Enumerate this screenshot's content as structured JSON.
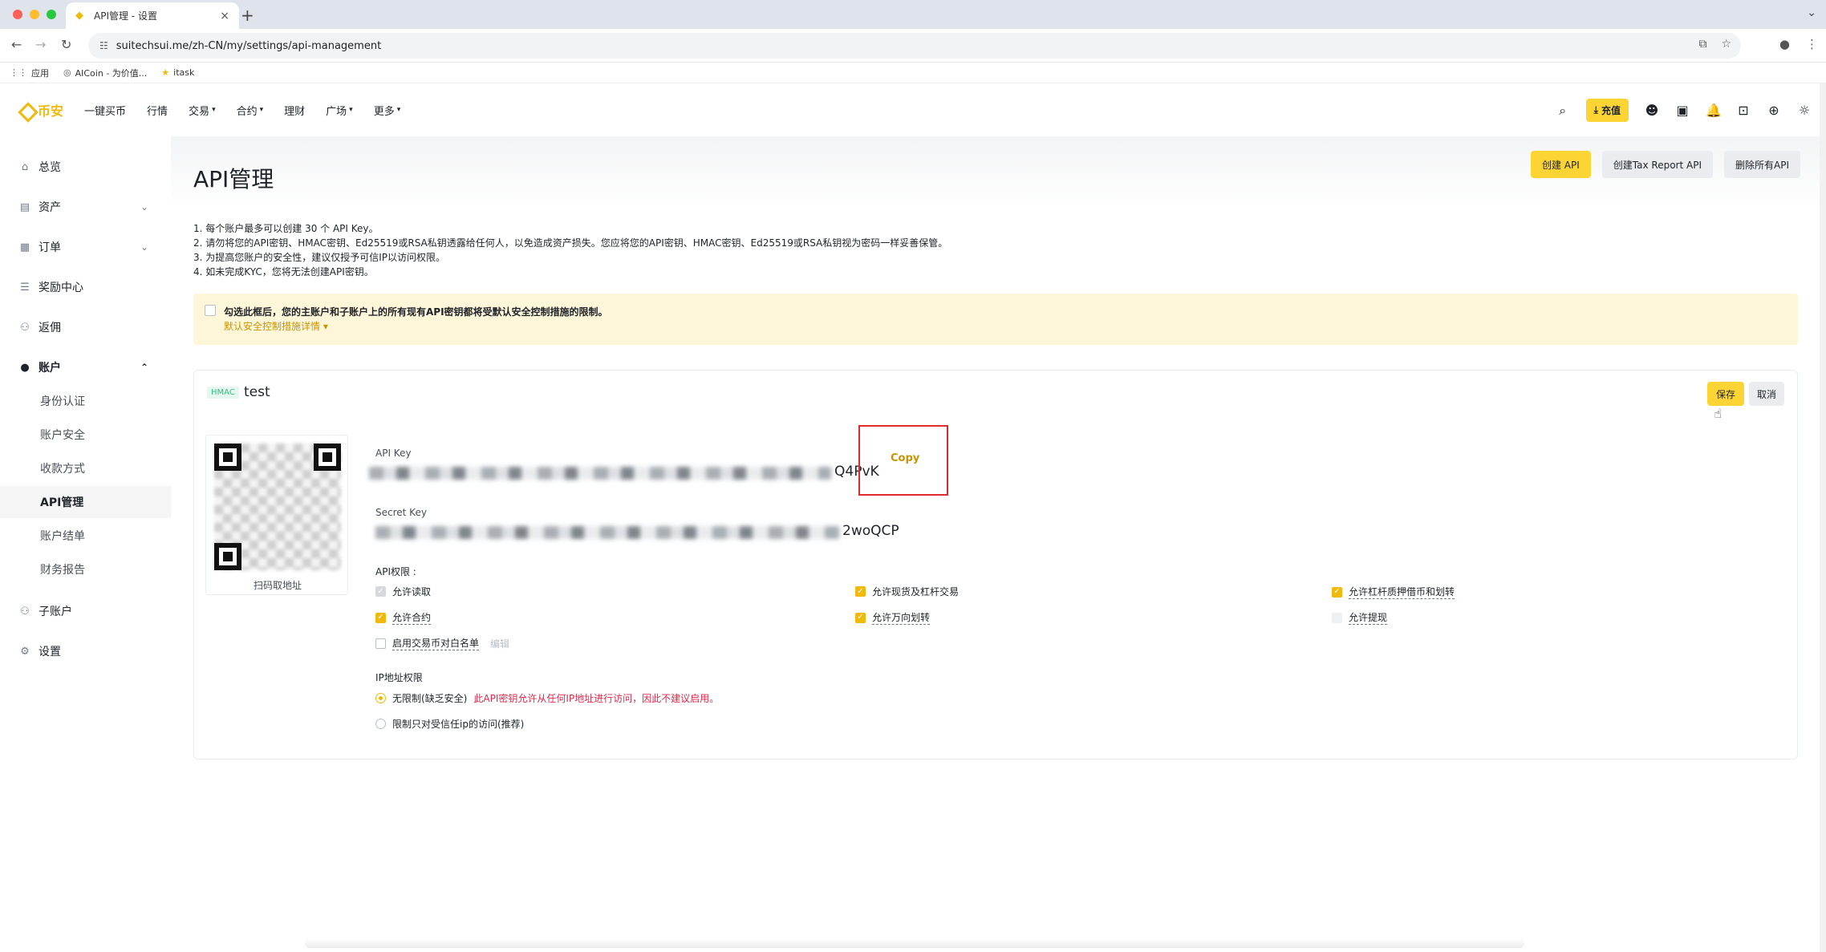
{
  "browser": {
    "tab_title": "API管理 - 设置",
    "url": "suitechsui.me/zh-CN/my/settings/api-management",
    "bookmarks": [
      "应用",
      "AICoin - 为价值...",
      "itask"
    ]
  },
  "header": {
    "logo_text": "币安",
    "nav": [
      "一键买币",
      "行情",
      "交易",
      "合约",
      "理财",
      "广场",
      "更多"
    ],
    "deposit_label": "充值"
  },
  "sidebar": {
    "items": [
      "总览",
      "资产",
      "订单",
      "奖励中心",
      "返佣",
      "账户"
    ],
    "account_sub": [
      "身份认证",
      "账户安全",
      "收款方式",
      "API管理",
      "账户结单",
      "财务报告"
    ],
    "after": [
      "子账户",
      "设置"
    ]
  },
  "page": {
    "title": "API管理",
    "buttons": {
      "create_api": "创建 API",
      "create_tax_api": "创建Tax Report API",
      "delete_all": "删除所有API"
    },
    "notes": [
      "1. 每个账户最多可以创建 30 个 API Key。",
      "2. 请勿将您的API密钥、HMAC密钥、Ed25519或RSA私钥透露给任何人，以免造成资产损失。您应将您的API密钥、HMAC密钥、Ed25519或RSA私钥视为密码一样妥善保管。",
      "3. 为提高您账户的安全性，建议仅授予可信IP以访问权限。",
      "4. 如未完成KYC，您将无法创建API密钥。"
    ],
    "warning": {
      "text": "勾选此框后，您的主账户和子账户上的所有现有API密钥都将受默认安全控制措施的限制。",
      "link": "默认安全控制措施详情"
    }
  },
  "api_card": {
    "tag": "HMAC",
    "name": "test",
    "save_label": "保存",
    "cancel_label": "取消",
    "qr_label": "扫码取地址",
    "api_key_label": "API Key",
    "api_key_visible_tail": "Q4PvK",
    "copy_label": "Copy",
    "secret_key_label": "Secret Key",
    "secret_key_visible_tail": "2woQCP",
    "permissions_title": "API权限 :",
    "permissions": {
      "read": {
        "label": "允许读取",
        "state": "checked-disabled"
      },
      "spot_margin": {
        "label": "允许现货及杠杆交易",
        "state": "checked"
      },
      "margin_loan": {
        "label": "允许杠杆质押借币和划转",
        "state": "checked"
      },
      "futures": {
        "label": "允许合约",
        "state": "checked"
      },
      "universal_transfer": {
        "label": "允许万向划转",
        "state": "checked"
      },
      "withdraw": {
        "label": "允许提现",
        "state": "unchecked-disabled"
      },
      "whitelist": {
        "label": "启用交易币对白名单",
        "state": "unchecked"
      }
    },
    "whitelist_edit": "编辑",
    "ip_title": "IP地址权限",
    "ip_unrestricted": "无限制(缺乏安全)",
    "ip_unrestricted_warning": "此API密钥允许从任何IP地址进行访问，因此不建议启用。",
    "ip_restricted": "限制只对受信任ip的访问(推荐)"
  }
}
